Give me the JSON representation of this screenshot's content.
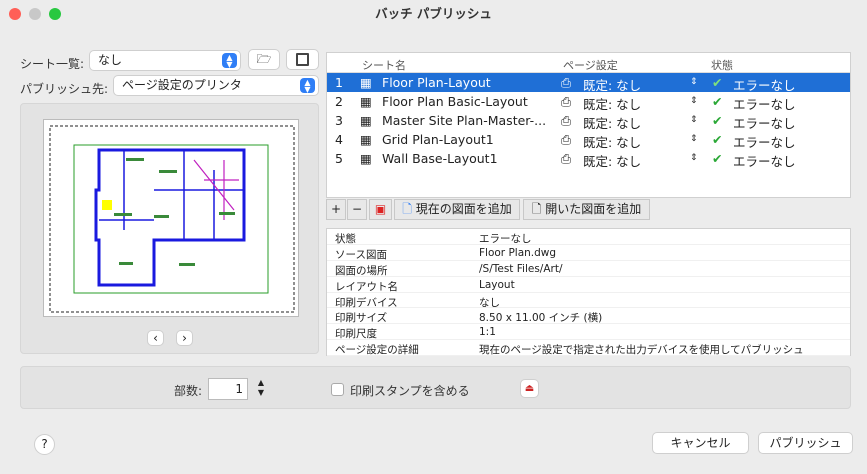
{
  "window": {
    "title": "バッチ パブリッシュ"
  },
  "sheet_list": {
    "label": "シート一覧:",
    "value": "なし"
  },
  "publish_to": {
    "label": "パブリッシュ先:",
    "value": "ページ設定のプリンタ"
  },
  "table": {
    "headers": [
      "シート名",
      "ページ設定",
      "状態"
    ],
    "rows": [
      {
        "num": "1",
        "name": "Floor Plan-Layout",
        "page_setup": "既定: なし",
        "status": "エラーなし",
        "selected": true
      },
      {
        "num": "2",
        "name": "Floor Plan Basic-Layout",
        "page_setup": "既定: なし",
        "status": "エラーなし"
      },
      {
        "num": "3",
        "name": "Master Site Plan-Master-...",
        "page_setup": "既定: なし",
        "status": "エラーなし"
      },
      {
        "num": "4",
        "name": "Grid Plan-Layout1",
        "page_setup": "既定: なし",
        "status": "エラーなし"
      },
      {
        "num": "5",
        "name": "Wall Base-Layout1",
        "page_setup": "既定: なし",
        "status": "エラーなし"
      }
    ]
  },
  "toolbar": {
    "add": "+",
    "remove": "−",
    "add_current": "現在の図面を追加",
    "add_open": "開いた図面を追加"
  },
  "properties": [
    {
      "key": "状態",
      "value": "エラーなし"
    },
    {
      "key": "ソース図面",
      "value": "Floor Plan.dwg"
    },
    {
      "key": "図面の場所",
      "value": "/S/Test Files/Art/"
    },
    {
      "key": "レイアウト名",
      "value": "Layout"
    },
    {
      "key": "印刷デバイス",
      "value": "なし"
    },
    {
      "key": "印刷サイズ",
      "value": "8.50 x 11.00 インチ (横)"
    },
    {
      "key": "印刷尺度",
      "value": "1:1"
    },
    {
      "key": "ページ設定の詳細",
      "value": "現在のページ設定で指定された出力デバイスを使用してパブリッシュ"
    }
  ],
  "copies": {
    "label": "部数:",
    "value": "1"
  },
  "stamp": {
    "label": "印刷スタンプを含める",
    "checked": false
  },
  "buttons": {
    "help": "?",
    "cancel": "キャンセル",
    "publish": "パブリッシュ"
  },
  "colors": {
    "accent": "#1f6fd6",
    "ok": "#2aa836"
  }
}
